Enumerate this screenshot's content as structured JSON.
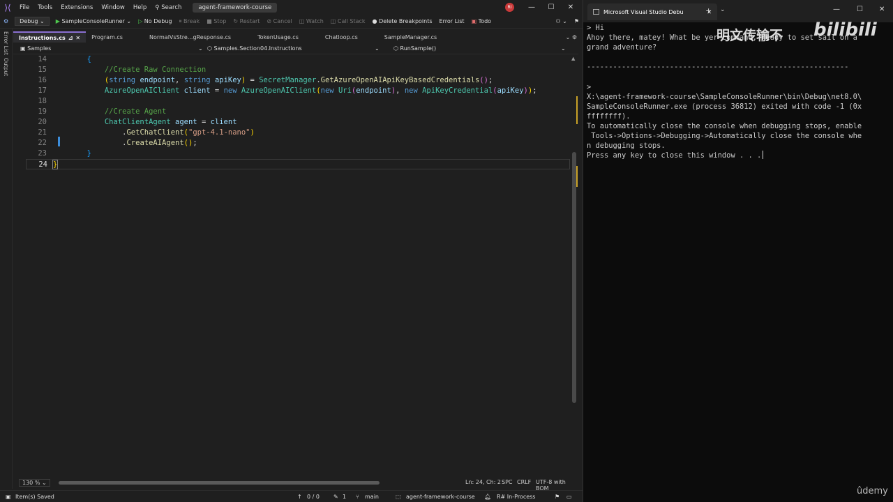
{
  "menu": {
    "items": [
      "File",
      "Tools",
      "Extensions",
      "Window",
      "Help"
    ],
    "search_label": "Search",
    "solution_name": "agent-framework-course",
    "avatar_initials": "RI"
  },
  "toolbar": {
    "config": "Debug",
    "startup_project": "SampleConsoleRunner",
    "no_debug": "No Debug",
    "break": "Break",
    "stop": "Stop",
    "restart": "Restart",
    "cancel": "Cancel",
    "watch": "Watch",
    "call_stack": "Call Stack",
    "delete_breakpoints": "Delete Breakpoints",
    "error_list": "Error List",
    "todo": "Todo"
  },
  "side_panels": [
    "Error List",
    "Output"
  ],
  "tabs": [
    {
      "label": "Instructions.cs",
      "active": true
    },
    {
      "label": "Program.cs"
    },
    {
      "label": "NormalVsStre...gResponse.cs"
    },
    {
      "label": "TokenUsage.cs"
    },
    {
      "label": "Chatloop.cs"
    },
    {
      "label": "SampleManager.cs"
    }
  ],
  "navbar": {
    "project": "Samples",
    "class": "Samples.Section04.Instructions",
    "member": "RunSample()"
  },
  "editor": {
    "line_numbers": [
      "14",
      "15",
      "16",
      "17",
      "18",
      "19",
      "20",
      "21",
      "22",
      "23",
      "24"
    ],
    "current_line": "24"
  },
  "editor_status": {
    "zoom": "130 %",
    "position": "Ln: 24, Ch: 2",
    "spacing": "SPC",
    "line_ending": "CRLF",
    "encoding": "UTF-8 with BOM"
  },
  "statusbar": {
    "message": "Item(s) Saved",
    "errors": "0 / 0",
    "changes": "1",
    "branch": "main",
    "repo": "agent-framework-course",
    "resharper": "R# In-Process"
  },
  "console": {
    "tab_title": "Microsoft Visual Studio Debu",
    "lines": [
      "> Hi",
      "Ahoy there, matey! What be yer command, ready to set sail on a",
      "grand adventure?",
      "",
      "------------------------------------------------------------",
      "",
      ">",
      "X:\\agent-framework-course\\SampleConsoleRunner\\bin\\Debug\\net8.0\\",
      "SampleConsoleRunner.exe (process 36812) exited with code -1 (0x",
      "ffffffff).",
      "To automatically close the console when debugging stops, enable",
      " Tools->Options->Debugging->Automatically close the console whe",
      "n debugging stops.",
      "Press any key to close this window . . ."
    ]
  },
  "watermark": {
    "text": "明文传输不",
    "brand": "bilibili"
  },
  "udemy": "ûdemy"
}
